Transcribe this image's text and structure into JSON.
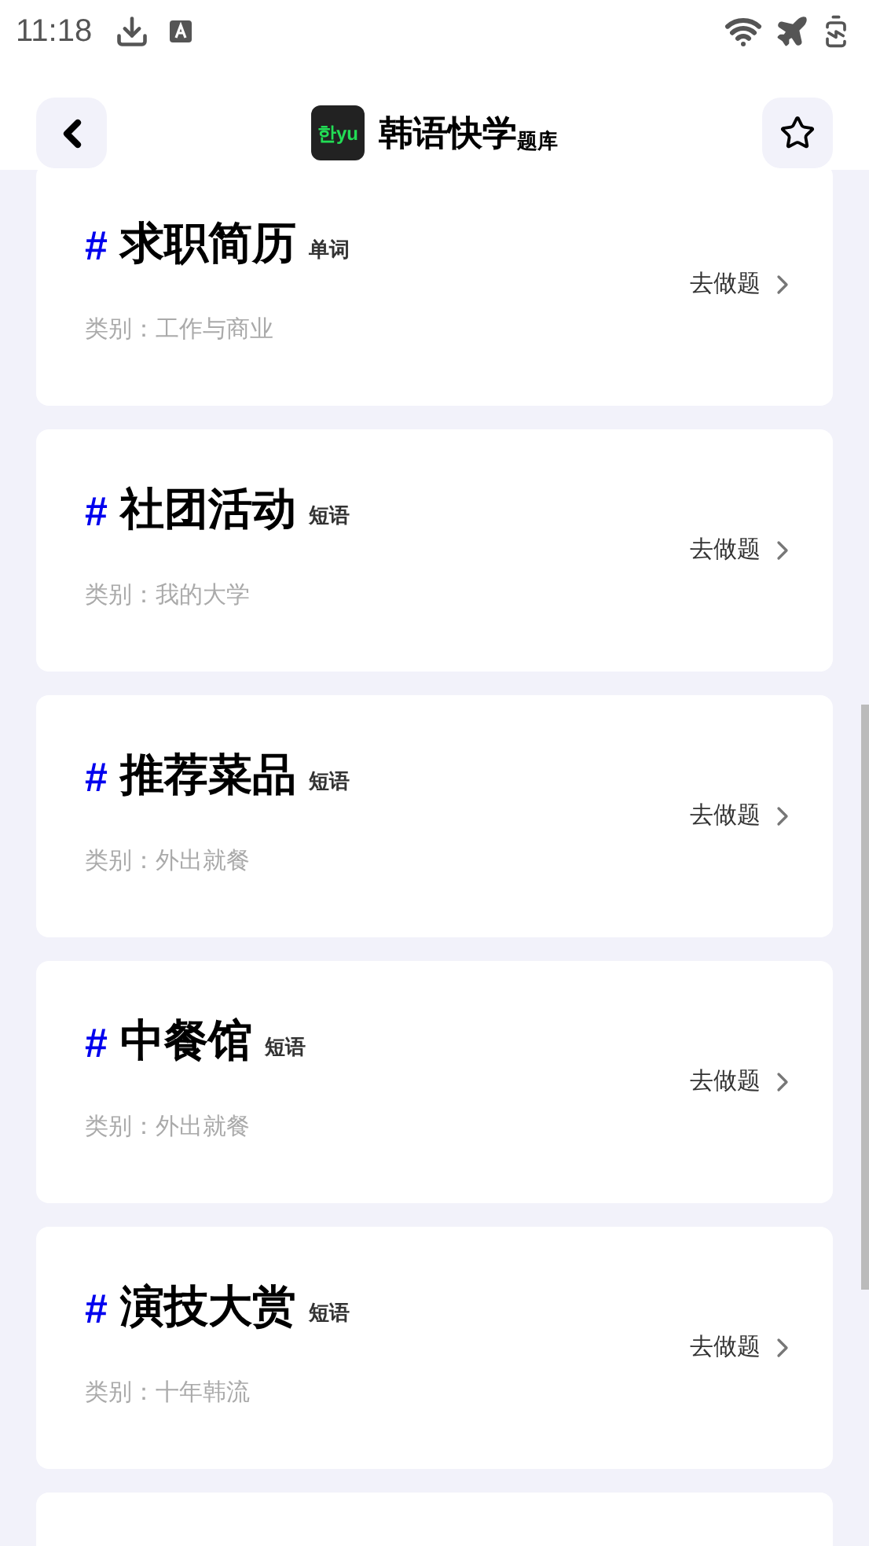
{
  "status_bar": {
    "time": "11:18"
  },
  "header": {
    "logo_text": "한yu",
    "title": "韩语快学",
    "subtitle": "题库"
  },
  "cards": [
    {
      "hash": "#",
      "title": "求职简历",
      "tag": "单词",
      "category": "类别：工作与商业",
      "action": "去做题"
    },
    {
      "hash": "#",
      "title": "社团活动",
      "tag": "短语",
      "category": "类别：我的大学",
      "action": "去做题"
    },
    {
      "hash": "#",
      "title": "推荐菜品",
      "tag": "短语",
      "category": "类别：外出就餐",
      "action": "去做题"
    },
    {
      "hash": "#",
      "title": "中餐馆",
      "tag": "短语",
      "category": "类别：外出就餐",
      "action": "去做题"
    },
    {
      "hash": "#",
      "title": "演技大赏",
      "tag": "短语",
      "category": "类别：十年韩流",
      "action": "去做题"
    }
  ]
}
